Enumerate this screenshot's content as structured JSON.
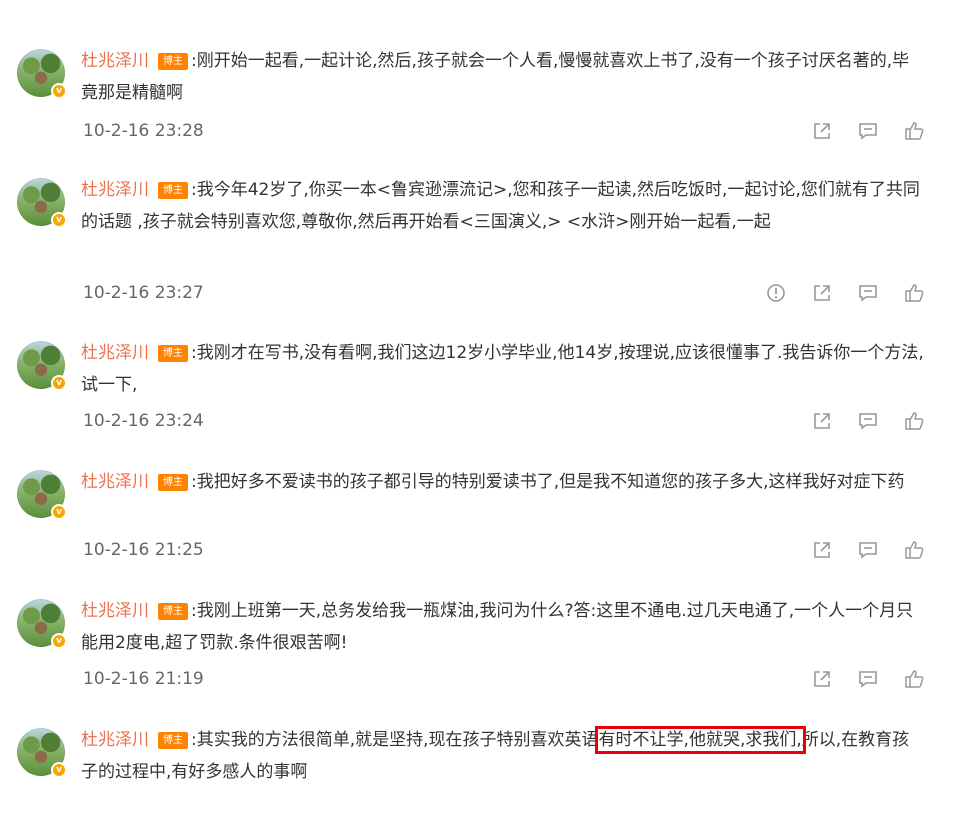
{
  "comments": [
    {
      "author": "杜兆泽川",
      "badge": "博主",
      "text": ":刚开始一起看,一起计论,然后,孩子就会一个人看,慢慢就喜欢上书了,没有一个孩子讨厌名著的,毕竟那是精髓啊",
      "time": "10-2-16 23:28",
      "icons": [
        "share-icon",
        "comment-icon",
        "like-icon"
      ]
    },
    {
      "author": "杜兆泽川",
      "badge": "博主",
      "text": ":我今年42岁了,你买一本<鲁宾逊漂流记>,您和孩子一起读,然后吃饭时,一起讨论,您们就有了共同的话题 ,孩子就会特别喜欢您,尊敬你,然后再开始看<三国演义,> <水浒>刚开始一起看,一起",
      "time": "10-2-16 23:27",
      "icons": [
        "report-icon",
        "share-icon",
        "comment-icon",
        "like-icon"
      ]
    },
    {
      "author": "杜兆泽川",
      "badge": "博主",
      "text": ":我刚才在写书,没有看啊,我们这边12岁小学毕业,他14岁,按理说,应该很懂事了.我告诉你一个方法,试一下,",
      "time": "10-2-16 23:24",
      "icons": [
        "share-icon",
        "comment-icon",
        "like-icon"
      ]
    },
    {
      "author": "杜兆泽川",
      "badge": "博主",
      "text": ":我把好多不爱读书的孩子都引导的特别爱读书了,但是我不知道您的孩子多大,这样我好对症下药",
      "time": "10-2-16 21:25",
      "icons": [
        "share-icon",
        "comment-icon",
        "like-icon"
      ]
    },
    {
      "author": "杜兆泽川",
      "badge": "博主",
      "text": ":我刚上班第一天,总务发给我一瓶煤油,我问为什么?答:这里不通电.过几天电通了,一个人一个月只能用2度电,超了罚款.条件很艰苦啊!",
      "time": "10-2-16 21:19",
      "icons": [
        "share-icon",
        "comment-icon",
        "like-icon"
      ]
    },
    {
      "author": "杜兆泽川",
      "badge": "博主",
      "text_before": ":其实我的方法很简单,就是坚持,现在孩子特别喜欢英语",
      "text_highlight": "有时不让学,他就哭,求我们,",
      "text_after": "所以,在教育孩子的过程中,有好多感人的事啊"
    }
  ],
  "colors": {
    "name": "#eb7350",
    "badge": "#ff8200",
    "highlight_box": "#e60012",
    "verified": "#f8a700"
  }
}
